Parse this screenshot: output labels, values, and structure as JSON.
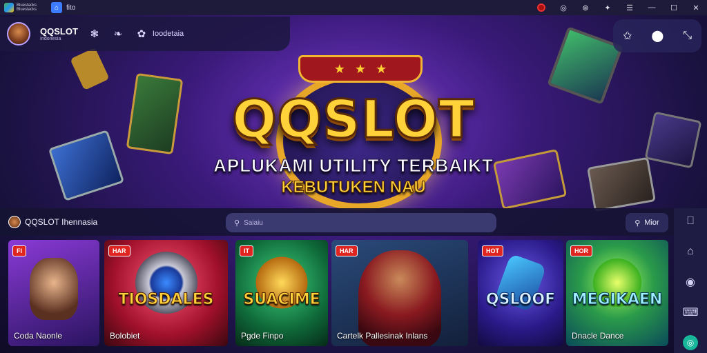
{
  "window": {
    "app_name_line1": "Bluestacks",
    "app_name_line2": "Bluestacks",
    "tab_label": "fito"
  },
  "header": {
    "brand_title": "QQSLOT",
    "brand_subtitle": "Indonesia",
    "nav_label": "Ioodetaia"
  },
  "hero": {
    "title": "QQSLOT",
    "tagline": "APLUKAMI UTILITY TERBAIKT",
    "subtagline": "KEBUTUKEN NAU"
  },
  "search_row": {
    "brand": "QQSLOT Ihennasia",
    "search_placeholder": "Saiaiu",
    "more_label": "Mior"
  },
  "cards": [
    {
      "tag": "FI",
      "title": "",
      "label": "Coda Naonle",
      "theme": "purple"
    },
    {
      "tag": "HAR",
      "title": "TIOSDALES",
      "label": "Bolobiet",
      "theme": "red"
    },
    {
      "tag": "IT",
      "title": "SUACIME",
      "label": "Pgde Finpo",
      "theme": "green"
    },
    {
      "tag": "HAR",
      "title": "",
      "label": "Cartelk Pallesinak Inlans",
      "theme": "dark-red"
    },
    {
      "tag": "HOT",
      "title": "QSLOOF",
      "label": "",
      "theme": "blue"
    },
    {
      "tag": "HOR",
      "title": "MEGIKAEN",
      "label": "Dnacle Dance",
      "theme": "teal"
    }
  ],
  "colors": {
    "accent": "#ffd23a",
    "brand_red": "#e0241f",
    "sidebar_active": "#18b69b",
    "background": "#140f2e"
  },
  "icons": {
    "title_bar": [
      "record-icon",
      "gamepad-icon",
      "rocket-icon",
      "puzzle-icon",
      "menu-icon",
      "minimize-icon",
      "maximize-icon",
      "close-icon"
    ],
    "header": [
      "paw-icon",
      "leaf-icon",
      "flower-icon"
    ],
    "top_right": [
      "star-icon",
      "location-icon",
      "compress-icon"
    ],
    "sidebar": [
      "message-icon",
      "folder-icon",
      "settings-icon",
      "keyboard-icon",
      "gamepad-icon"
    ]
  }
}
